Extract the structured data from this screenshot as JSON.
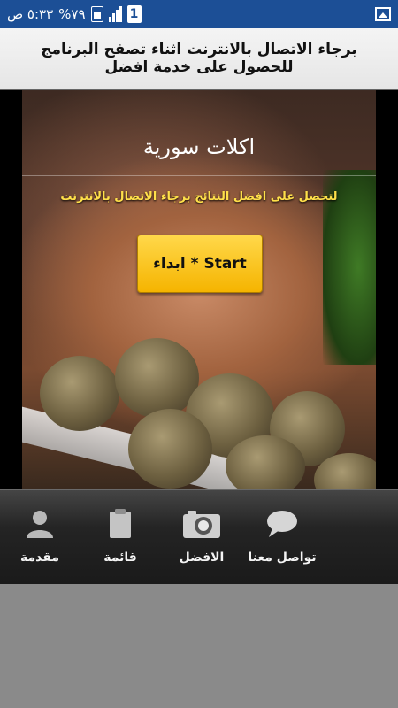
{
  "status_bar": {
    "time": "٥:٣٣ ص",
    "battery": "%٧٩",
    "sim": "1"
  },
  "notice": {
    "text": "برجاء الاتصال بالانترنت اثناء تصفح البرنامج للحصول على خدمة افضل"
  },
  "hero": {
    "title": "اكلات سورية",
    "subtitle": "لتحصل على افضل النتائج برجاء الاتصال بالانترنت",
    "start_label": "ابداء * Start"
  },
  "bottom_nav": {
    "items": [
      {
        "label": "مقدمة",
        "icon": "person-icon"
      },
      {
        "label": "قائمة",
        "icon": "clipboard-icon"
      },
      {
        "label": "الافضل",
        "icon": "camera-icon"
      },
      {
        "label": "تواصل معنا",
        "icon": "chat-bubble-icon"
      }
    ]
  },
  "colors": {
    "status_bar": "#1c4f96",
    "start_button": "#ffd84a",
    "subtitle": "#ffe04a"
  }
}
